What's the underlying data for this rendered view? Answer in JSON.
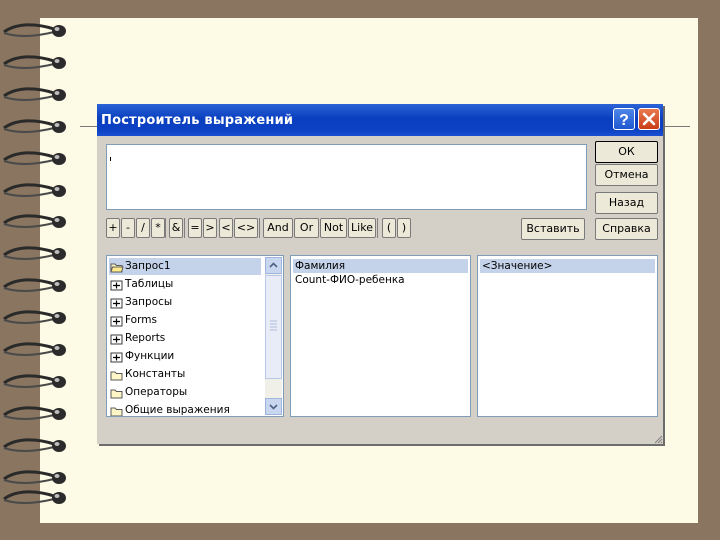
{
  "dialog": {
    "title": "Построитель выражений",
    "expression_value": ""
  },
  "side_buttons": {
    "ok": "ОК",
    "cancel": "Отмена",
    "back": "Назад",
    "help": "Справка"
  },
  "operators": [
    "+",
    "-",
    "/",
    "*",
    "&",
    "=",
    ">",
    "<",
    "<>",
    "And",
    "Or",
    "Not",
    "Like",
    "(",
    ")"
  ],
  "paste_button": "Вставить",
  "tree": {
    "items": [
      {
        "label": "Запрос1",
        "icon": "folder-open-icon"
      },
      {
        "label": "Таблицы",
        "icon": "folder-plus-icon"
      },
      {
        "label": "Запросы",
        "icon": "folder-plus-icon"
      },
      {
        "label": "Forms",
        "icon": "folder-plus-icon"
      },
      {
        "label": "Reports",
        "icon": "folder-plus-icon"
      },
      {
        "label": "Функции",
        "icon": "folder-plus-icon"
      },
      {
        "label": "Константы",
        "icon": "folder-icon"
      },
      {
        "label": "Операторы",
        "icon": "folder-icon"
      },
      {
        "label": "Общие выражения",
        "icon": "folder-icon"
      }
    ]
  },
  "fields_list": [
    "Фамилия",
    "Count-ФИО-ребенка"
  ],
  "values_list": [
    "<Значение>"
  ],
  "colors": {
    "titlebar": "#0a3fbf",
    "selection": "#c5d3ea",
    "dialog_face": "#d4d0c8",
    "paper": "#fdfbe6"
  }
}
